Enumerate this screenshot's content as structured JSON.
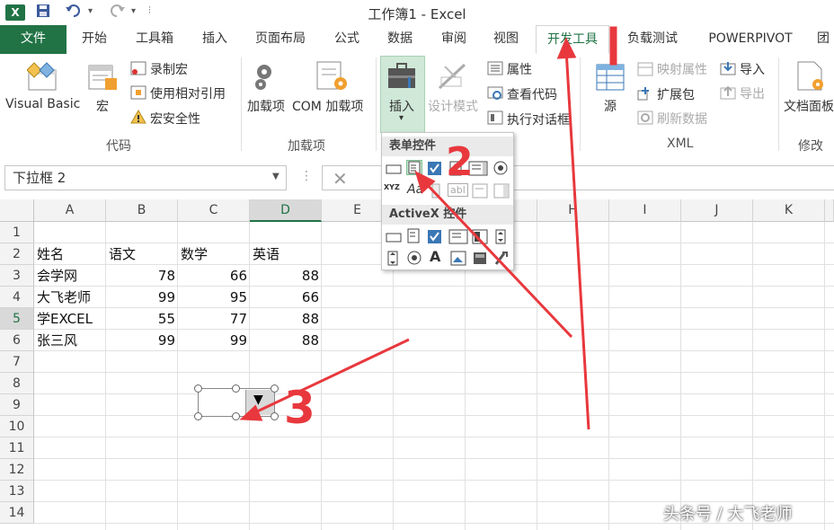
{
  "window": {
    "title": "工作簿1 - Excel",
    "app_icon": "X"
  },
  "tabs": [
    {
      "label": "文件"
    },
    {
      "label": "开始"
    },
    {
      "label": "工具箱"
    },
    {
      "label": "插入"
    },
    {
      "label": "页面布局"
    },
    {
      "label": "公式"
    },
    {
      "label": "数据"
    },
    {
      "label": "审阅"
    },
    {
      "label": "视图"
    },
    {
      "label": "开发工具"
    },
    {
      "label": "负载测试"
    },
    {
      "label": "POWERPIVOT"
    },
    {
      "label": "团"
    }
  ],
  "ribbon": {
    "code": {
      "visual_basic": "Visual Basic",
      "macros": "宏",
      "record_macro": "录制宏",
      "relative_ref": "使用相对引用",
      "macro_security": "宏安全性",
      "group": "代码"
    },
    "addins": {
      "addins": "加载项",
      "com_addins": "COM 加载项",
      "group": "加载项"
    },
    "controls": {
      "insert": "插入",
      "design_mode": "设计模式",
      "properties": "属性",
      "view_code": "查看代码",
      "run_dialog": "执行对话框"
    },
    "xml": {
      "source": "源",
      "map_props": "映射属性",
      "expansion": "扩展包",
      "refresh": "刷新数据",
      "import": "导入",
      "export": "导出",
      "group": "XML"
    },
    "modify": {
      "doc_panel": "文档面板",
      "group": "修改"
    }
  },
  "namebox": {
    "value": "下拉框 2"
  },
  "columns": [
    "A",
    "B",
    "C",
    "D",
    "E",
    "F",
    "G",
    "H",
    "I",
    "J",
    "K"
  ],
  "rows": [
    "1",
    "2",
    "3",
    "4",
    "5",
    "6",
    "7",
    "8",
    "9",
    "10",
    "11",
    "12",
    "13",
    "14"
  ],
  "table": {
    "header": [
      "姓名",
      "语文",
      "数学",
      "英语"
    ],
    "data": [
      [
        "会学网",
        "78",
        "66",
        "88"
      ],
      [
        "大飞老师",
        "99",
        "95",
        "66"
      ],
      [
        "学EXCEL",
        "55",
        "77",
        "88"
      ],
      [
        "张三风",
        "99",
        "99",
        "88"
      ]
    ]
  },
  "popup": {
    "form_controls": "表单控件",
    "activex_controls": "ActiveX 控件"
  },
  "annotations": {
    "n1": "1",
    "n2": "2",
    "n3": "3"
  },
  "watermark": "头条号 / 大飞老师",
  "colors": {
    "accent": "#217346",
    "arrow": "#e8383d"
  }
}
